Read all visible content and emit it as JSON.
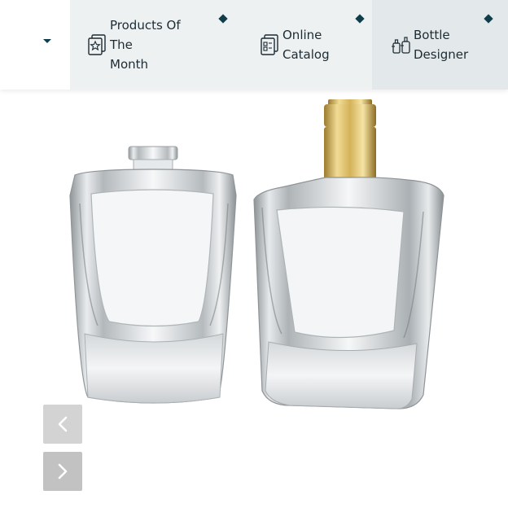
{
  "nav": {
    "items": [
      {
        "label_line1": "Products Of The",
        "label_line2": "Month",
        "icon": "star-document-icon"
      },
      {
        "label_line1": "Online",
        "label_line2": "Catalog",
        "icon": "catalog-icon"
      },
      {
        "label_line1": "Bottle",
        "label_line2": "Designer",
        "icon": "bottles-icon"
      }
    ]
  },
  "gallery": {
    "prev_icon": "chevron-left-icon",
    "next_icon": "chevron-right-icon"
  },
  "colors": {
    "accent": "#0f3d4c",
    "nav_bg": "#eef1f2",
    "nav_active_bg": "#e3e8ea",
    "button_bg": "#c7c7c7",
    "cap_gold": "#d4b25a"
  }
}
